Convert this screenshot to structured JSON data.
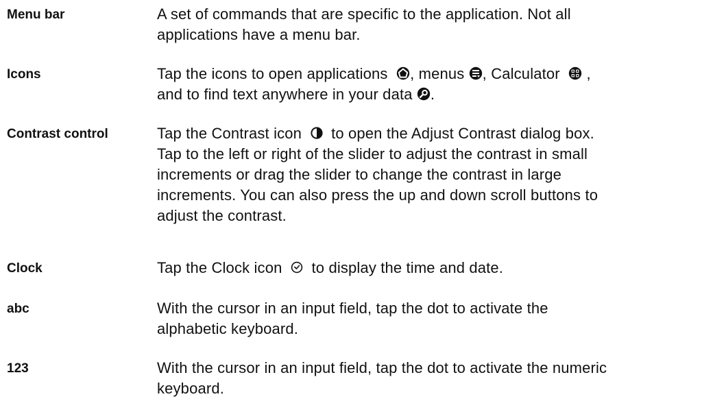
{
  "definitions": [
    {
      "term": "Menu bar",
      "lines": [
        "A set of commands that are specific to the application. Not all",
        "applications have a menu bar."
      ]
    },
    {
      "term": "Icons",
      "line1": {
        "a": "Tap the icons to open applications",
        "b": ", menus",
        "c": ", Calculator",
        "d": ","
      },
      "line2": {
        "a": "and to find text anywhere in your data",
        "b": "."
      },
      "icons": [
        "applications-icon",
        "menus-icon",
        "calculator-icon",
        "find-icon"
      ]
    },
    {
      "term": "Contrast control",
      "line1": {
        "a": "Tap the Contrast icon",
        "b": "to open the Adjust Contrast dialog box."
      },
      "lines": [
        "Tap to the left or right of the slider to adjust the contrast in small",
        "increments or drag the slider to change the contrast in large",
        "increments. You can also press the up and down scroll buttons to",
        "adjust the contrast."
      ],
      "icons": [
        "contrast-icon"
      ]
    },
    {
      "term": "Clock",
      "line1": {
        "a": "Tap the Clock icon",
        "b": "to display the time and date."
      },
      "icons": [
        "clock-icon"
      ]
    },
    {
      "term": "abc",
      "lines": [
        "With the cursor in an input field, tap the dot to activate the",
        "alphabetic keyboard."
      ]
    },
    {
      "term": "123",
      "lines": [
        "With the cursor in an input field, tap the dot to activate the numeric",
        "keyboard."
      ]
    }
  ]
}
